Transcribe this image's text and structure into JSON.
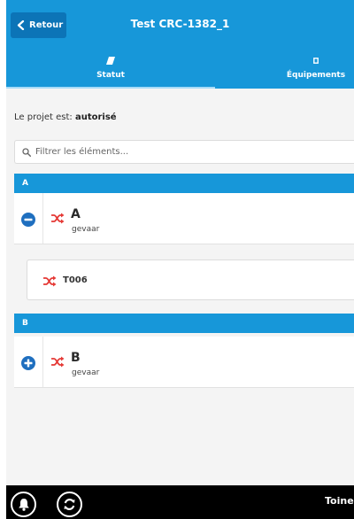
{
  "header": {
    "back_label": "Retour",
    "title": "Test CRC-1382_1"
  },
  "tabs": [
    {
      "label": "Statut",
      "icon": "eraser-icon",
      "active": true
    },
    {
      "label": "Équipements",
      "icon": "square-icon",
      "active": false
    }
  ],
  "status": {
    "prefix": "Le projet est:",
    "value": "autorisé"
  },
  "filter": {
    "placeholder": "Filtrer les éléments..."
  },
  "sections": [
    {
      "header": "A",
      "group": {
        "title": "A",
        "subtitle": "gevaar",
        "expanded": true,
        "icon": "shuffle-icon"
      },
      "children": [
        {
          "label": "T006",
          "icon": "shuffle-icon"
        }
      ]
    },
    {
      "header": "B",
      "group": {
        "title": "B",
        "subtitle": "gevaar",
        "expanded": false,
        "icon": "shuffle-icon"
      },
      "children": []
    }
  ],
  "footer": {
    "user": "Toine v"
  },
  "colors": {
    "primary": "#1797d9",
    "back_button": "#0c74b7",
    "toggle": "#1f6fbf",
    "shuffle": "#e53935",
    "bottom_bar": "#000000"
  }
}
